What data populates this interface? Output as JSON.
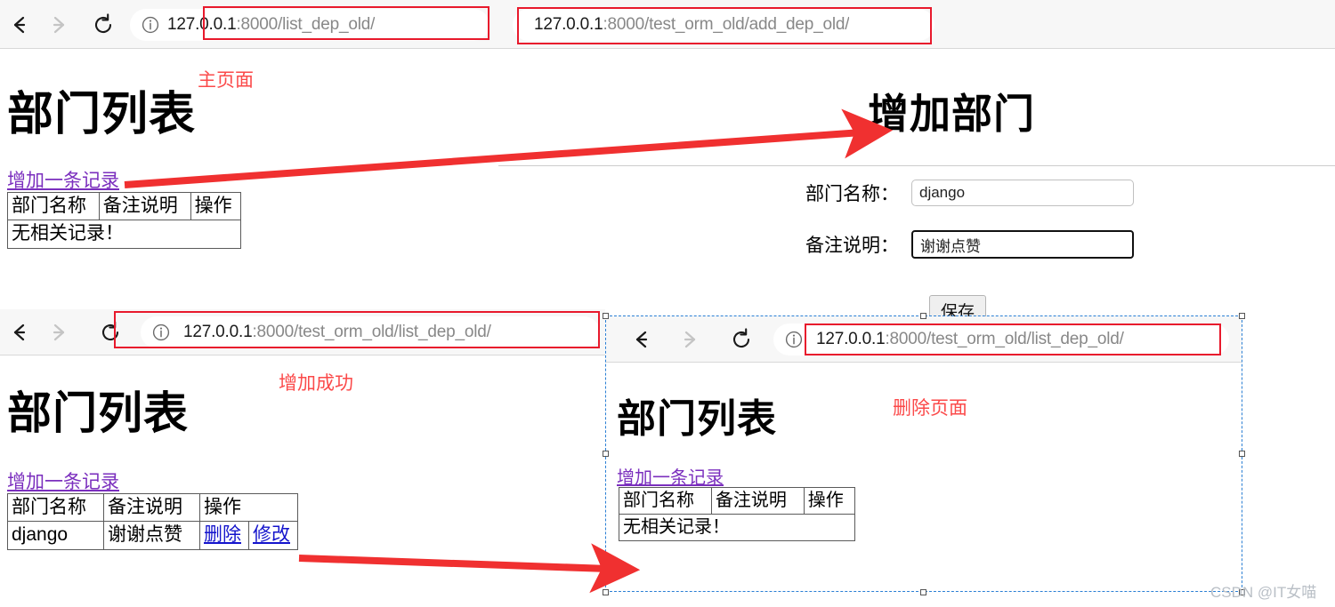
{
  "windows": {
    "top_left": {
      "name": "list-dep-old-window",
      "url_host": "127.0.0.1",
      "url_path": ":8000/list_dep_old/",
      "back_icon": "back-arrow-icon",
      "forward_icon": "forward-arrow-icon",
      "reload_icon": "reload-icon",
      "info_icon": "info-icon",
      "page": {
        "title": "部门列表",
        "add_link": "增加一条记录",
        "columns": [
          "部门名称",
          "备注说明",
          "操作"
        ],
        "empty_text": "无相关记录！"
      },
      "annotation": "主页面"
    },
    "top_right": {
      "name": "add-dep-old-window",
      "url_host": "127.0.0.1",
      "url_path": ":8000/test_orm_old/add_dep_old/",
      "page": {
        "title": "增加部门",
        "field_name_label": "部门名称：",
        "field_name_value": "django",
        "field_note_label": "备注说明：",
        "field_note_value": "谢谢点赞",
        "save_label": "保存"
      }
    },
    "mid_left": {
      "name": "list-dep-old-after-add-window",
      "url_host": "127.0.0.1",
      "url_path": ":8000/test_orm_old/list_dep_old/",
      "page": {
        "title": "部门列表",
        "add_link": "增加一条记录",
        "columns": [
          "部门名称",
          "备注说明",
          "操作"
        ],
        "rows": [
          {
            "dep_name": "django",
            "note": "谢谢点赞",
            "delete_label": "删除",
            "edit_label": "修改"
          }
        ]
      },
      "annotation": "增加成功"
    },
    "bottom_right": {
      "name": "list-dep-old-after-delete-window",
      "url_host": "127.0.0.1",
      "url_path": ":8000/test_orm_old/list_dep_old/",
      "page": {
        "title": "部门列表",
        "add_link": "增加一条记录",
        "columns": [
          "部门名称",
          "备注说明",
          "操作"
        ],
        "empty_text": "无相关记录！"
      },
      "annotation": "删除页面"
    }
  },
  "colors": {
    "annotation_red": "#fb4a4a",
    "highlight_box_red": "#e8192c",
    "arrow_red": "#f03030",
    "link_purple": "#7b2fbe",
    "op_link_blue": "#1414cc",
    "selection_blue": "#2a7fd4"
  },
  "watermark": "CSDN @IT女喵"
}
